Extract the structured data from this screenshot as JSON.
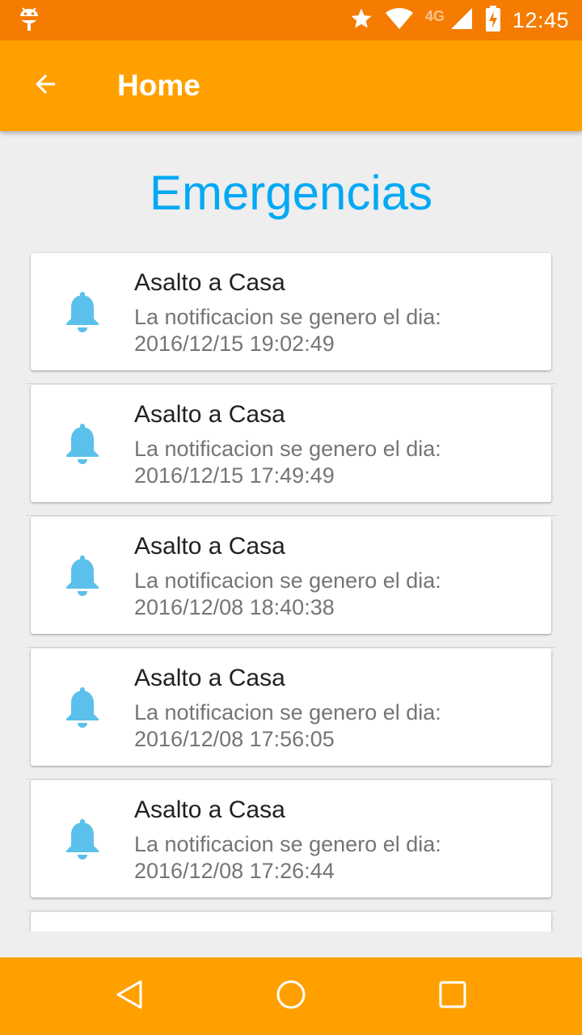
{
  "status_bar": {
    "network": "4G",
    "time": "12:45"
  },
  "app_bar": {
    "title": "Home"
  },
  "page": {
    "heading": "Emergencias"
  },
  "notifications": [
    {
      "title": "Asalto a Casa",
      "line1": "La notificacion se genero el dia:",
      "line2": "2016/12/15 19:02:49"
    },
    {
      "title": "Asalto a Casa",
      "line1": "La notificacion se genero el dia:",
      "line2": "2016/12/15 17:49:49"
    },
    {
      "title": "Asalto a Casa",
      "line1": "La notificacion se genero el dia:",
      "line2": "2016/12/08 18:40:38"
    },
    {
      "title": "Asalto a Casa",
      "line1": "La notificacion se genero el dia:",
      "line2": "2016/12/08 17:56:05"
    },
    {
      "title": "Asalto a Casa",
      "line1": "La notificacion se genero el dia:",
      "line2": "2016/12/08 17:26:44"
    }
  ],
  "icons": {
    "status_left": "android-debug-icon",
    "star": "star-icon",
    "wifi": "wifi-icon",
    "signal": "signal-icon",
    "battery": "battery-charging-icon",
    "back": "arrow-back-icon",
    "notification": "bell-icon",
    "nav_back": "nav-back-icon",
    "nav_home": "nav-home-icon",
    "nav_recents": "nav-recents-icon"
  },
  "colors": {
    "status_bar": "#f57c00",
    "app_bar": "#ffa000",
    "heading": "#03a9f4",
    "bell": "#5bc0eb",
    "background": "#eeeeee"
  }
}
